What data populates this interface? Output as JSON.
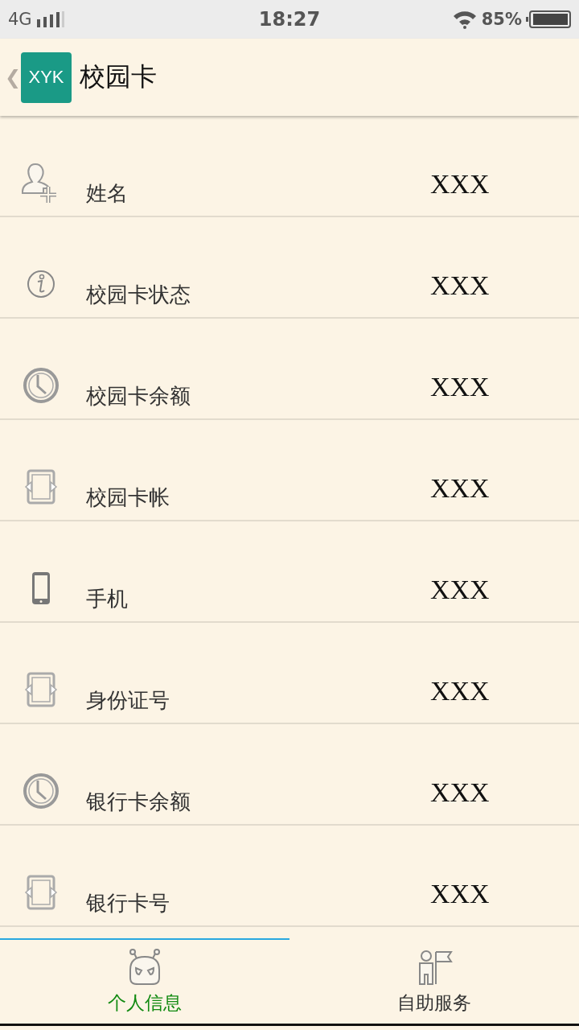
{
  "status_bar": {
    "network": "4G",
    "time": "18:27",
    "battery": "85%"
  },
  "header": {
    "back": "❮",
    "logo": "XYK",
    "title": "校园卡"
  },
  "rows": [
    {
      "label": "姓名",
      "value": "XXX"
    },
    {
      "label": "校园卡状态",
      "value": "XXX"
    },
    {
      "label": "校园卡余额",
      "value": "XXX"
    },
    {
      "label": "校园卡帐",
      "value": "XXX"
    },
    {
      "label": "手机",
      "value": "XXX"
    },
    {
      "label": "身份证号",
      "value": "XXX"
    },
    {
      "label": "银行卡余额",
      "value": "XXX"
    },
    {
      "label": "银行卡号",
      "value": "XXX"
    }
  ],
  "tabs": [
    {
      "label": "个人信息",
      "selected": true
    },
    {
      "label": "自助服务",
      "selected": false
    }
  ]
}
